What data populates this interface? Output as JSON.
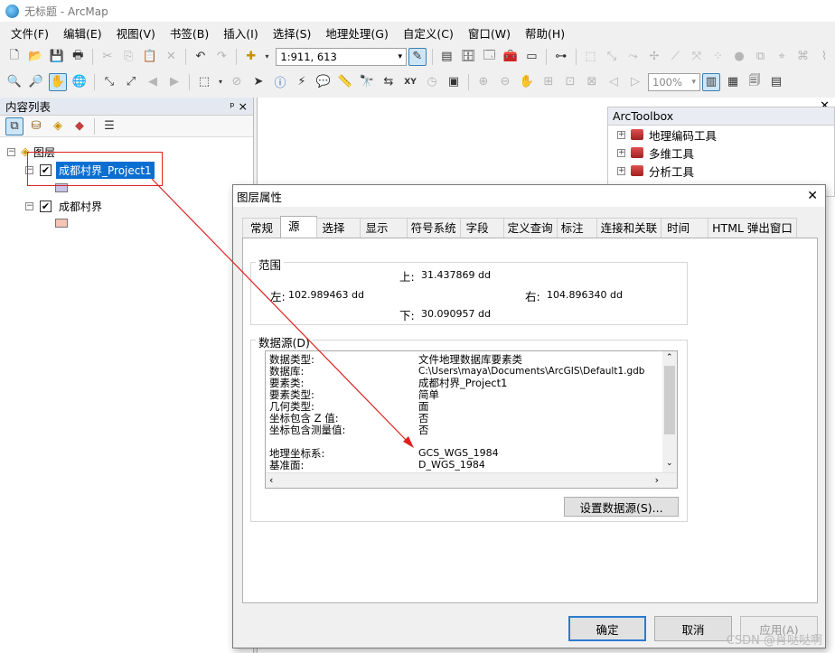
{
  "window": {
    "title": "无标题 - ArcMap"
  },
  "menu": [
    "文件(F)",
    "编辑(E)",
    "视图(V)",
    "书签(B)",
    "插入(I)",
    "选择(S)",
    "地理处理(G)",
    "自定义(C)",
    "窗口(W)",
    "帮助(H)"
  ],
  "toolbar": {
    "scale": "1:911, 613",
    "zoom": "100%"
  },
  "toc": {
    "title": "内容列表",
    "pin": "ᵖ ×",
    "root": "图层",
    "layers": [
      {
        "name": "成都村界_Project1",
        "selected": true,
        "swatch": "#c9c3e8"
      },
      {
        "name": "成都村界",
        "selected": false,
        "swatch": "#f4c4b4"
      }
    ]
  },
  "arctoolbox": {
    "title": "ArcToolbox",
    "items": [
      "地理编码工具",
      "多维工具",
      "分析工具"
    ]
  },
  "dialog": {
    "title": "图层属性",
    "tabs": [
      "常规",
      "源",
      "选择",
      "显示",
      "符号系统",
      "字段",
      "定义查询",
      "标注",
      "连接和关联",
      "时间",
      "HTML 弹出窗口"
    ],
    "active_tab": "源",
    "extent": {
      "label": "范围",
      "top_label": "上:",
      "top": "31.437869 dd",
      "left_label": "左:",
      "left": "102.989463 dd",
      "right_label": "右:",
      "right": "104.896340 dd",
      "bottom_label": "下:",
      "bottom": "30.090957 dd"
    },
    "datasource": {
      "label": "数据源(D)",
      "rows": [
        {
          "k": "数据类型:",
          "v": "文件地理数据库要素类"
        },
        {
          "k": "数据库:",
          "v": "C:\\Users\\maya\\Documents\\ArcGIS\\Default1.gdb"
        },
        {
          "k": "要素类:",
          "v": "成都村界_Project1"
        },
        {
          "k": "要素类型:",
          "v": "简单"
        },
        {
          "k": "几何类型:",
          "v": "面"
        },
        {
          "k": "坐标包含 Z 值:",
          "v": "否"
        },
        {
          "k": "坐标包含测量值:",
          "v": "否"
        },
        {
          "k": "",
          "v": ""
        },
        {
          "k": "地理坐标系:",
          "v": "GCS_WGS_1984"
        },
        {
          "k": "基准面:",
          "v": "D_WGS_1984"
        }
      ],
      "set_button": "设置数据源(S)..."
    },
    "buttons": {
      "ok": "确定",
      "cancel": "取消",
      "apply": "应用(A)"
    }
  },
  "watermark": "CSDN @肖哒哒啊"
}
